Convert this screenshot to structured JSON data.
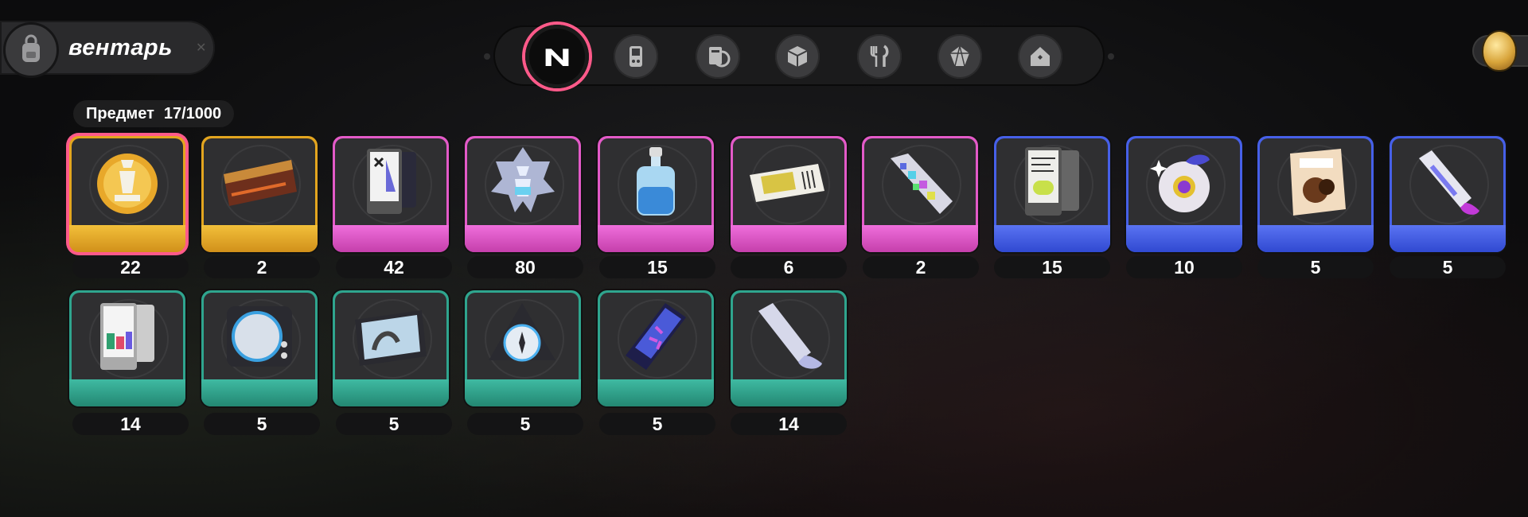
{
  "header": {
    "title": "вентарь",
    "icon": "backpack-icon"
  },
  "tabs": [
    {
      "name": "tab-logo",
      "icon": "n-logo-icon",
      "active": true
    },
    {
      "name": "tab-device",
      "icon": "handheld-device-icon",
      "active": false
    },
    {
      "name": "tab-disc",
      "icon": "disc-case-icon",
      "active": false
    },
    {
      "name": "tab-box",
      "icon": "cube-box-icon",
      "active": false
    },
    {
      "name": "tab-food",
      "icon": "fork-knife-icon",
      "active": false
    },
    {
      "name": "tab-crystal",
      "icon": "crystal-icon",
      "active": false
    },
    {
      "name": "tab-home",
      "icon": "home-icon",
      "active": false
    }
  ],
  "inventory": {
    "label": "Предмет",
    "count": "17/1000"
  },
  "colors": {
    "gold": "#e3a51f",
    "pink": "#e35ac8",
    "blue": "#4660e8",
    "teal": "#2fa58e",
    "accent": "#ff5a8a"
  },
  "items": [
    {
      "icon": "chess-trophy-icon",
      "rarity": "gold",
      "qty": "22",
      "selected": true
    },
    {
      "icon": "ticket-card-icon",
      "rarity": "gold",
      "qty": "2"
    },
    {
      "icon": "tablet-card-icon",
      "rarity": "pink",
      "qty": "42"
    },
    {
      "icon": "crystal-emblem-icon",
      "rarity": "pink",
      "qty": "80"
    },
    {
      "icon": "bottle-icon",
      "rarity": "pink",
      "qty": "15"
    },
    {
      "icon": "ticket-icon",
      "rarity": "pink",
      "qty": "6"
    },
    {
      "icon": "pixel-tube-icon",
      "rarity": "pink",
      "qty": "2"
    },
    {
      "icon": "tablet-icon",
      "rarity": "blue",
      "qty": "15"
    },
    {
      "icon": "fruit-icon",
      "rarity": "blue",
      "qty": "10"
    },
    {
      "icon": "snack-bag-icon",
      "rarity": "blue",
      "qty": "5"
    },
    {
      "icon": "paint-tube-icon",
      "rarity": "blue",
      "qty": "5"
    },
    {
      "icon": "tablet-card-icon",
      "rarity": "teal",
      "qty": "14"
    },
    {
      "icon": "turntable-icon",
      "rarity": "teal",
      "qty": "5"
    },
    {
      "icon": "monitor-icon",
      "rarity": "teal",
      "qty": "5"
    },
    {
      "icon": "compass-device-icon",
      "rarity": "teal",
      "qty": "5"
    },
    {
      "icon": "capsule-icon",
      "rarity": "teal",
      "qty": "5"
    },
    {
      "icon": "paint-tube-icon",
      "rarity": "teal",
      "qty": "14"
    }
  ]
}
